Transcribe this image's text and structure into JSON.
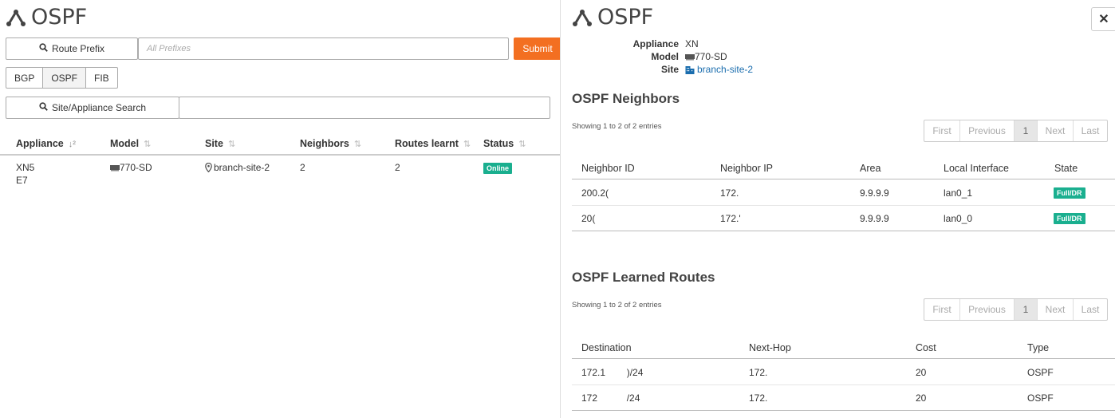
{
  "left": {
    "title": "OSPF",
    "route_prefix_button": "Route Prefix",
    "prefix_placeholder": "All Prefixes",
    "submit_label": "Submit",
    "tabs": [
      "BGP",
      "OSPF",
      "FIB"
    ],
    "site_search_button": "Site/Appliance Search",
    "table": {
      "columns": [
        "Appliance",
        "Model",
        "Site",
        "Neighbors",
        "Routes learnt",
        "Status"
      ],
      "row": {
        "appliance_line1": "XN5",
        "appliance_line2": "E7",
        "model": "770-SD",
        "site": "branch-site-2",
        "neighbors": "2",
        "routes": "2",
        "status": "Online"
      }
    }
  },
  "right": {
    "title": "OSPF",
    "close_label": "✕",
    "info": {
      "appliance_label": "Appliance",
      "appliance_value": "XN",
      "model_label": "Model",
      "model_value": "770-SD",
      "site_label": "Site",
      "site_value": "branch-site-2"
    },
    "neighbors": {
      "heading": "OSPF Neighbors",
      "showing": "Showing 1 to 2 of 2 entries",
      "pager": [
        "First",
        "Previous",
        "1",
        "Next",
        "Last"
      ],
      "columns": [
        "Neighbor ID",
        "Neighbor IP",
        "Area",
        "Local Interface",
        "State"
      ],
      "rows": [
        {
          "id": "200.2(",
          "ip": "172.",
          "area": "9.9.9.9",
          "iface": "lan0_1",
          "state": "Full/DR"
        },
        {
          "id": "20(",
          "ip": "172.'",
          "area": "9.9.9.9",
          "iface": "lan0_0",
          "state": "Full/DR"
        }
      ]
    },
    "routes": {
      "heading": "OSPF Learned Routes",
      "showing": "Showing 1 to 2 of 2 entries",
      "pager": [
        "First",
        "Previous",
        "1",
        "Next",
        "Last"
      ],
      "columns": [
        "Destination",
        "Next-Hop",
        "Cost",
        "Type"
      ],
      "rows": [
        {
          "dest": "172.1        )/24",
          "hop": "172.",
          "cost": "20",
          "type": "OSPF"
        },
        {
          "dest": "172           /24",
          "hop": "172.",
          "cost": "20",
          "type": "OSPF"
        }
      ]
    }
  }
}
